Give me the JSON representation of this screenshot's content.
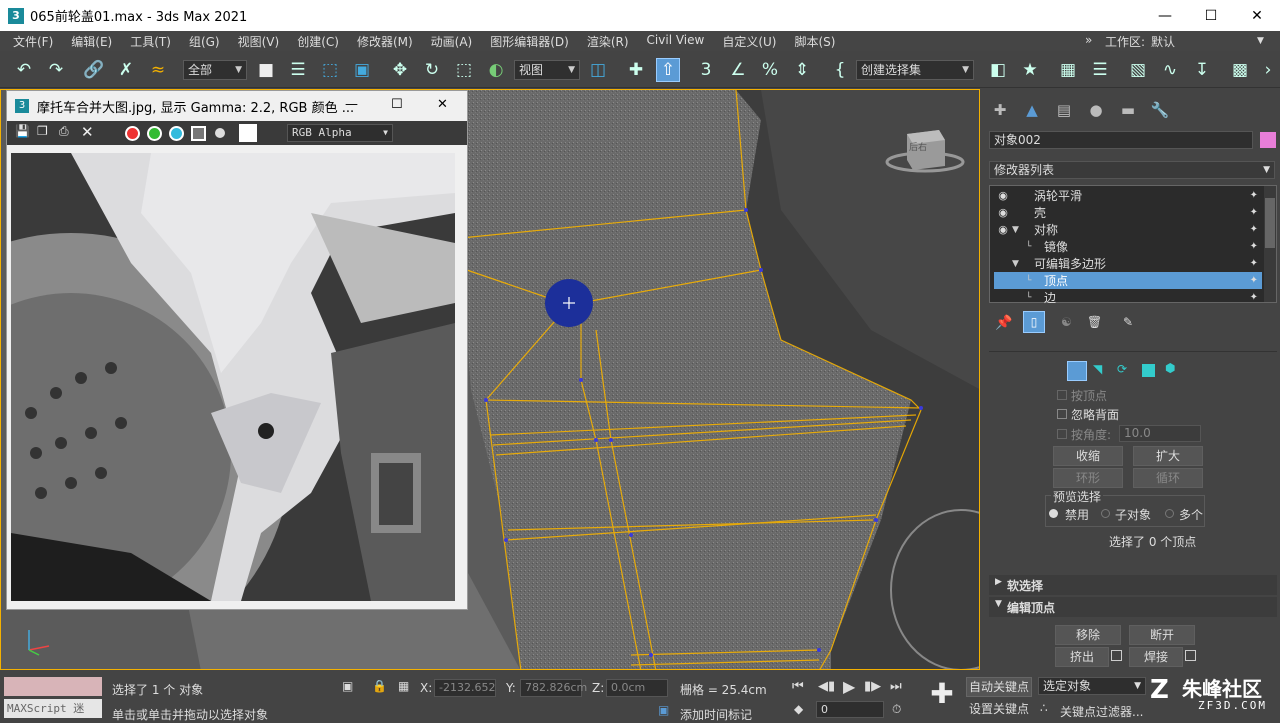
{
  "window": {
    "title": "065前轮盖01.max - 3ds Max 2021",
    "app_icon": "3"
  },
  "menu": [
    "文件(F)",
    "编辑(E)",
    "工具(T)",
    "组(G)",
    "视图(V)",
    "创建(C)",
    "修改器(M)",
    "动画(A)",
    "图形编辑器(D)",
    "渲染(R)",
    "Civil View",
    "自定义(U)",
    "脚本(S)"
  ],
  "workspace": {
    "label": "工作区:",
    "value": "默认"
  },
  "toolbar": {
    "filter": "全部",
    "ref_coord": "视图",
    "selection_set": "创建选择集"
  },
  "image_window": {
    "title": "摩托车合并大图.jpg, 显示 Gamma: 2.2, RGB 颜色 ...",
    "channel": "RGB Alpha"
  },
  "panel": {
    "object_name": "对象002",
    "modifier_list": "修改器列表",
    "stack": [
      {
        "label": "涡轮平滑",
        "eye": true,
        "indent": 0
      },
      {
        "label": "壳",
        "eye": true,
        "indent": 0
      },
      {
        "label": "对称",
        "eye": true,
        "indent": 0,
        "expanded": true
      },
      {
        "label": "镜像",
        "eye": false,
        "indent": 1
      },
      {
        "label": "可编辑多边形",
        "eye": false,
        "indent": 0,
        "expanded": true
      },
      {
        "label": "顶点",
        "eye": false,
        "indent": 1,
        "selected": true
      },
      {
        "label": "边",
        "eye": false,
        "indent": 1
      }
    ],
    "selection": {
      "by_vertex": "按顶点",
      "ignore_backfacing": "忽略背面",
      "by_angle": "按角度:",
      "angle_value": "10.0",
      "shrink": "收缩",
      "grow": "扩大",
      "ring": "环形",
      "loop": "循环",
      "preview_title": "预览选择",
      "preview_options": [
        "禁用",
        "子对象",
        "多个"
      ],
      "selected_info": "选择了 0 个顶点"
    },
    "soft_selection": "软选择",
    "edit_vertices": "编辑顶点",
    "remove": "移除",
    "break": "断开",
    "extrude": "挤出",
    "weld": "焊接"
  },
  "viewport": {
    "viewcube_label": "后右"
  },
  "status": {
    "maxscript": "MAXScript 迷",
    "selected": "选择了 1 个 对象",
    "hint": "单击或单击并拖动以选择对象",
    "x_label": "X:",
    "x_value": "-2132.652",
    "y_label": "Y:",
    "y_value": "782.826cm",
    "z_label": "Z:",
    "z_value": "0.0cm",
    "grid": "栅格 = 25.4cm",
    "add_time_tag": "添加时间标记",
    "frame": "0",
    "auto_key": "自动关键点",
    "set_key": "设置关键点",
    "selected_object": "选定对象",
    "key_filters": "关键点过滤器..."
  },
  "watermark": {
    "brand": "朱峰社区",
    "site": "ZF3D.COM"
  },
  "colors": {
    "accent": "#f4b100",
    "selection": "#5b9bd5",
    "vertex": "#3a3adc",
    "brush": "#1c2f9a"
  }
}
